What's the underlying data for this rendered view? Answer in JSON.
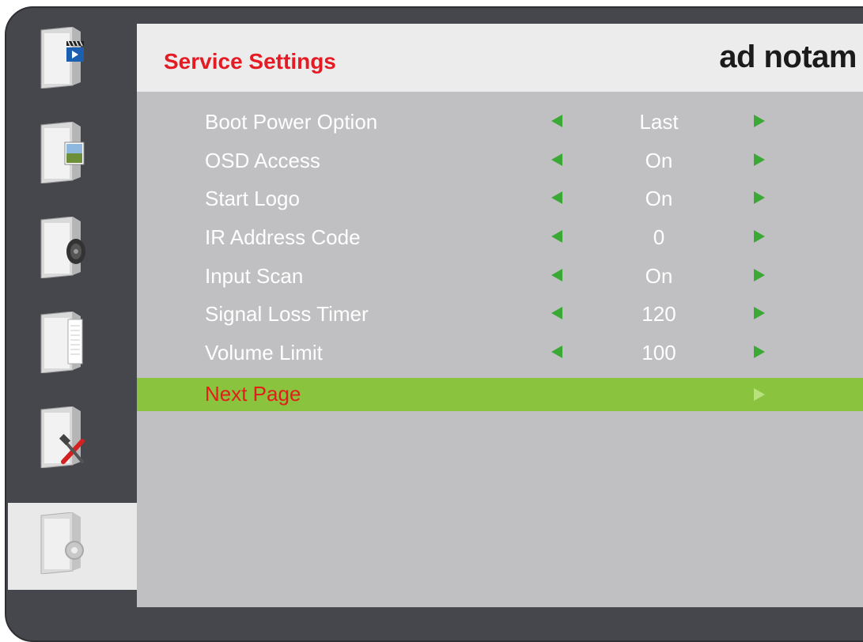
{
  "header": {
    "title": "Service Settings",
    "brand": "ad notam"
  },
  "colors": {
    "title": "#e51b24",
    "selected_row": "#8ac43f",
    "arrow": "#3aa935",
    "panel_bg": "#c0bfc1",
    "frame": "#45474c"
  },
  "sidebar": {
    "items": [
      {
        "icon": "video-folder-icon",
        "active": false
      },
      {
        "icon": "picture-folder-icon",
        "active": false
      },
      {
        "icon": "audio-folder-icon",
        "active": false
      },
      {
        "icon": "document-folder-icon",
        "active": false
      },
      {
        "icon": "tools-folder-icon",
        "active": false
      },
      {
        "icon": "settings-folder-icon",
        "active": true
      }
    ]
  },
  "menu": {
    "items": [
      {
        "label": "Boot Power Option",
        "value": "Last"
      },
      {
        "label": "OSD Access",
        "value": "On"
      },
      {
        "label": "Start Logo",
        "value": "On"
      },
      {
        "label": "IR Address Code",
        "value": "0"
      },
      {
        "label": "Input Scan",
        "value": "On"
      },
      {
        "label": "Signal Loss Timer",
        "value": "120"
      },
      {
        "label": "Volume Limit",
        "value": "100"
      }
    ],
    "next": {
      "label": "Next Page"
    }
  }
}
